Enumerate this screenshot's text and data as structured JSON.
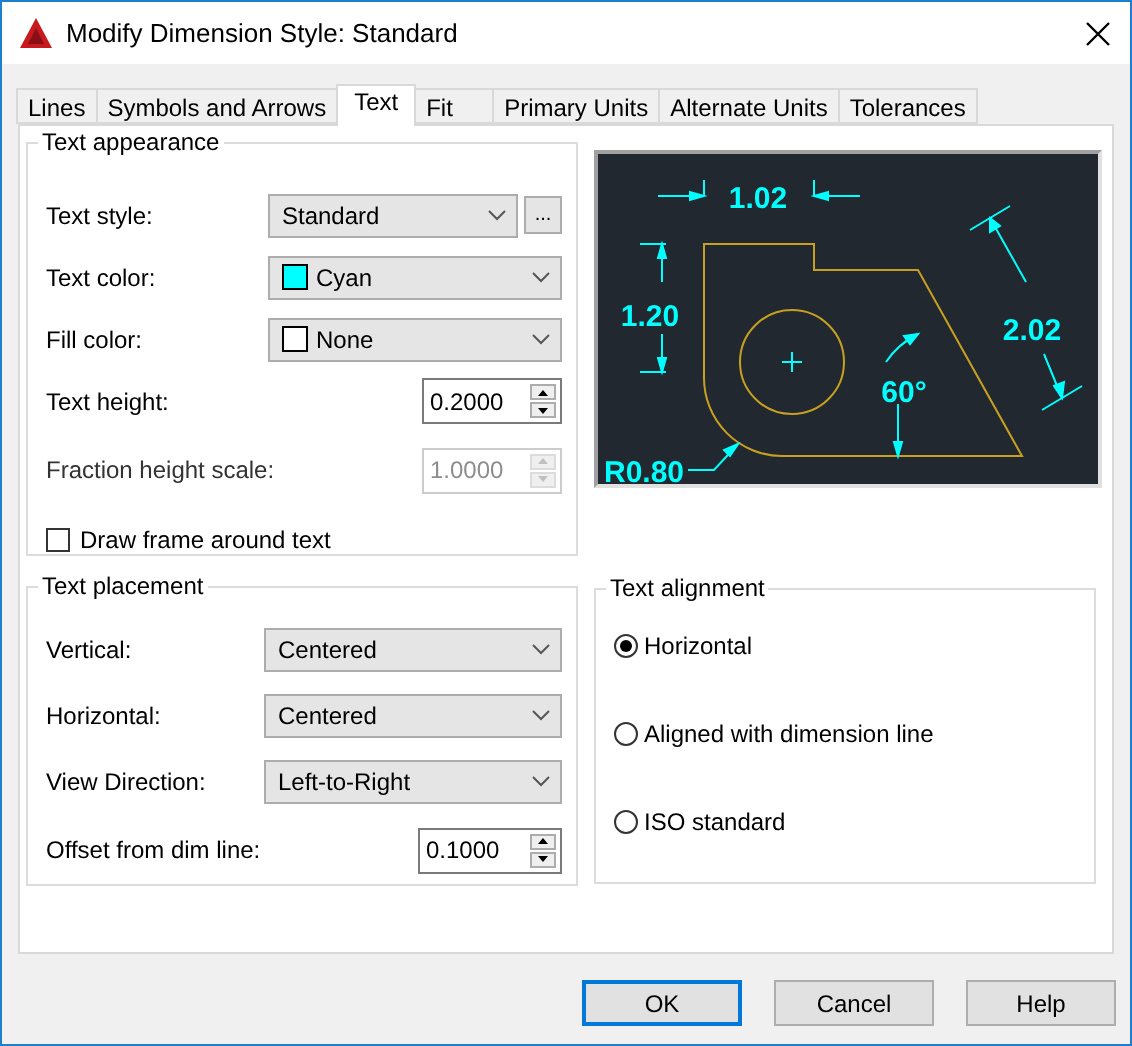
{
  "window": {
    "title": "Modify Dimension Style: Standard"
  },
  "tabs": [
    {
      "label": "Lines",
      "selected": false
    },
    {
      "label": "Symbols and Arrows",
      "selected": false
    },
    {
      "label": "Text",
      "selected": true
    },
    {
      "label": "Fit",
      "selected": false
    },
    {
      "label": "Primary Units",
      "selected": false
    },
    {
      "label": "Alternate Units",
      "selected": false
    },
    {
      "label": "Tolerances",
      "selected": false
    }
  ],
  "text_appearance": {
    "title": "Text appearance",
    "fields": [
      {
        "kind": "select",
        "label": "Text style:",
        "value": "Standard",
        "browse": "..."
      },
      {
        "kind": "color_select",
        "label": "Text color:",
        "value": "Cyan",
        "color": "#00ffff"
      },
      {
        "kind": "color_select",
        "label": "Fill color:",
        "value": "None",
        "color": "#ffffff"
      },
      {
        "kind": "spinner",
        "label": "Text height:",
        "value": "0.2000",
        "disabled": false
      },
      {
        "kind": "spinner",
        "label": "Fraction height scale:",
        "value": "1.0000",
        "disabled": true
      },
      {
        "kind": "checkbox",
        "label": "Draw frame around text",
        "checked": false
      }
    ]
  },
  "preview": {
    "labels": [
      "1.02",
      "1.20",
      "2.02",
      "60°",
      "R0.80"
    ]
  },
  "text_placement": {
    "title": "Text placement",
    "fields": [
      {
        "kind": "select",
        "label": "Vertical:",
        "value": "Centered"
      },
      {
        "kind": "select",
        "label": "Horizontal:",
        "value": "Centered"
      },
      {
        "kind": "select",
        "label": "View Direction:",
        "value": "Left-to-Right"
      },
      {
        "kind": "spinner",
        "label": "Offset from dim line:",
        "value": "0.1000",
        "disabled": false
      }
    ]
  },
  "text_alignment": {
    "title": "Text alignment",
    "options": [
      {
        "label": "Horizontal",
        "selected": true
      },
      {
        "label": "Aligned with dimension line",
        "selected": false
      },
      {
        "label": "ISO standard",
        "selected": false
      }
    ]
  },
  "buttons": [
    {
      "label": "OK",
      "default": true
    },
    {
      "label": "Cancel",
      "default": false
    },
    {
      "label": "Help",
      "default": false
    }
  ]
}
